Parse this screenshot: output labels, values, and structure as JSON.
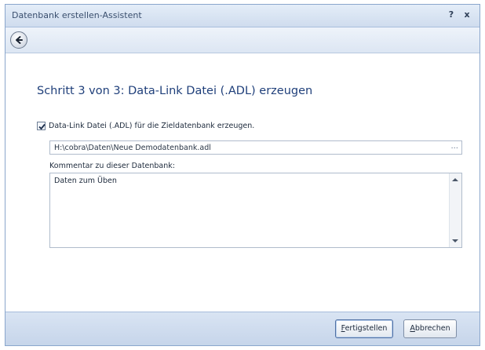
{
  "window": {
    "title": "Datenbank erstellen-Assistent",
    "help_label": "?",
    "close_label": "x"
  },
  "step": {
    "title": "Schritt 3 von 3: Data-Link Datei (.ADL) erzeugen"
  },
  "adl": {
    "checkbox_checked": true,
    "checkbox_label": "Data-Link Datei (.ADL) für die Zieldatenbank erzeugen.",
    "path_value": "H:\\cobra\\Daten\\Neue Demodatenbank.adl",
    "browse_label": "..."
  },
  "comment": {
    "label": "Kommentar zu dieser Datenbank:",
    "value": "Daten zum Üben"
  },
  "footer": {
    "finish_first": "F",
    "finish_rest": "ertigstellen",
    "cancel_first": "A",
    "cancel_rest": "bbrechen"
  },
  "icons": {
    "back": "back-arrow-icon",
    "check": "checkmark-icon"
  },
  "colors": {
    "accent": "#1f3f7a",
    "titlebar": "#cfdcee",
    "footer": "#c6d5ea"
  }
}
